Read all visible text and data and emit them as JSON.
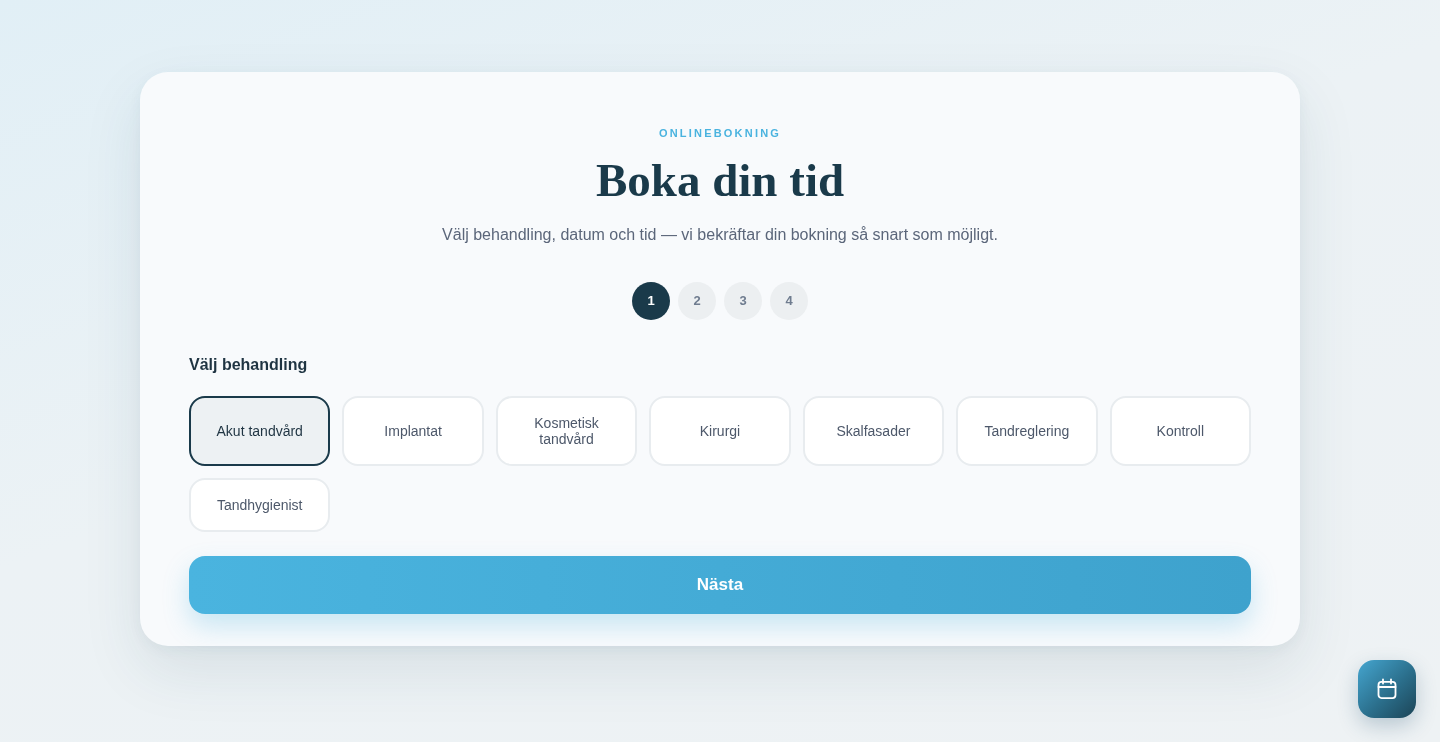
{
  "header": {
    "eyebrow": "ONLINEBOKNING",
    "title": "Boka din tid",
    "subtitle": "Välj behandling, datum och tid — vi bekräftar din bokning så snart som möjligt."
  },
  "steps": [
    {
      "label": "1",
      "selected": true
    },
    {
      "label": "2",
      "selected": false
    },
    {
      "label": "3",
      "selected": false
    },
    {
      "label": "4",
      "selected": false
    }
  ],
  "treatments": {
    "label": "Välj behandling",
    "options": [
      {
        "label": "Akut tandvård",
        "selected": true
      },
      {
        "label": "Implantat",
        "selected": false
      },
      {
        "label": "Kosmetisk tandvård",
        "selected": false
      },
      {
        "label": "Kirurgi",
        "selected": false
      },
      {
        "label": "Skalfasader",
        "selected": false
      },
      {
        "label": "Tandreglering",
        "selected": false
      },
      {
        "label": "Kontroll",
        "selected": false
      },
      {
        "label": "Tandhygienist",
        "selected": false
      }
    ]
  },
  "next_button": {
    "label": "Nästa"
  }
}
